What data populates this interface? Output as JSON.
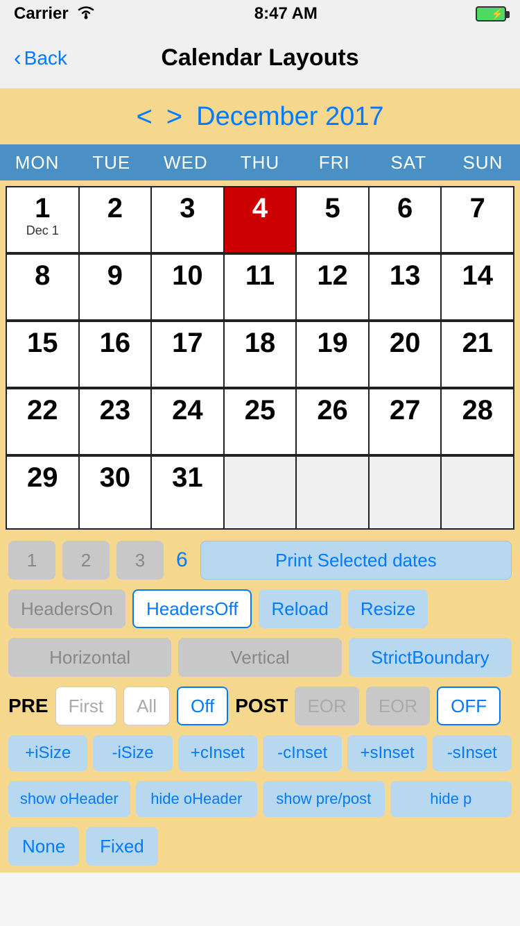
{
  "statusBar": {
    "carrier": "Carrier",
    "time": "8:47 AM"
  },
  "navBar": {
    "backLabel": "Back",
    "title": "Calendar Layouts"
  },
  "calendarHeader": {
    "prevArrow": "<",
    "nextArrow": ">",
    "monthYear": "December 2017"
  },
  "dayHeaders": [
    "MON",
    "TUE",
    "WED",
    "THU",
    "FRI",
    "SAT",
    "SUN"
  ],
  "weeks": [
    [
      {
        "num": "1",
        "sub": "Dec 1",
        "today": false,
        "empty": false
      },
      {
        "num": "2",
        "sub": "",
        "today": false,
        "empty": false
      },
      {
        "num": "3",
        "sub": "",
        "today": false,
        "empty": false
      },
      {
        "num": "4",
        "sub": "",
        "today": true,
        "empty": false
      },
      {
        "num": "5",
        "sub": "",
        "today": false,
        "empty": false
      },
      {
        "num": "6",
        "sub": "",
        "today": false,
        "empty": false
      },
      {
        "num": "7",
        "sub": "",
        "today": false,
        "empty": false
      }
    ],
    [
      {
        "num": "8",
        "sub": "",
        "today": false,
        "empty": false
      },
      {
        "num": "9",
        "sub": "",
        "today": false,
        "empty": false
      },
      {
        "num": "10",
        "sub": "",
        "today": false,
        "empty": false
      },
      {
        "num": "11",
        "sub": "",
        "today": false,
        "empty": false
      },
      {
        "num": "12",
        "sub": "",
        "today": false,
        "empty": false
      },
      {
        "num": "13",
        "sub": "",
        "today": false,
        "empty": false
      },
      {
        "num": "14",
        "sub": "",
        "today": false,
        "empty": false
      }
    ],
    [
      {
        "num": "15",
        "sub": "",
        "today": false,
        "empty": false
      },
      {
        "num": "16",
        "sub": "",
        "today": false,
        "empty": false
      },
      {
        "num": "17",
        "sub": "",
        "today": false,
        "empty": false
      },
      {
        "num": "18",
        "sub": "",
        "today": false,
        "empty": false
      },
      {
        "num": "19",
        "sub": "",
        "today": false,
        "empty": false
      },
      {
        "num": "20",
        "sub": "",
        "today": false,
        "empty": false
      },
      {
        "num": "21",
        "sub": "",
        "today": false,
        "empty": false
      }
    ],
    [
      {
        "num": "22",
        "sub": "",
        "today": false,
        "empty": false
      },
      {
        "num": "23",
        "sub": "",
        "today": false,
        "empty": false
      },
      {
        "num": "24",
        "sub": "",
        "today": false,
        "empty": false
      },
      {
        "num": "25",
        "sub": "",
        "today": false,
        "empty": false
      },
      {
        "num": "26",
        "sub": "",
        "today": false,
        "empty": false
      },
      {
        "num": "27",
        "sub": "",
        "today": false,
        "empty": false
      },
      {
        "num": "28",
        "sub": "",
        "today": false,
        "empty": false
      }
    ],
    [
      {
        "num": "29",
        "sub": "",
        "today": false,
        "empty": false
      },
      {
        "num": "30",
        "sub": "",
        "today": false,
        "empty": false
      },
      {
        "num": "31",
        "sub": "",
        "today": false,
        "empty": false
      },
      {
        "num": "",
        "sub": "",
        "today": false,
        "empty": true
      },
      {
        "num": "",
        "sub": "",
        "today": false,
        "empty": true
      },
      {
        "num": "",
        "sub": "",
        "today": false,
        "empty": true
      },
      {
        "num": "",
        "sub": "",
        "today": false,
        "empty": true
      }
    ]
  ],
  "controls": {
    "numBtns": [
      "1",
      "2",
      "3",
      "6"
    ],
    "printLabel": "Print Selected dates",
    "headersOnLabel": "HeadersOn",
    "headersOffLabel": "HeadersOff",
    "reloadLabel": "Reload",
    "resizeLabel": "Resize",
    "horizontalLabel": "Horizontal",
    "verticalLabel": "Vertical",
    "strictBoundaryLabel": "StrictBoundary",
    "preLabel": "PRE",
    "postLabel": "POST",
    "firstLabel": "First",
    "allLabel": "All",
    "offLabel": "Off",
    "eor1Label": "EOR",
    "eor2Label": "EOR",
    "offActiveLabel": "OFF",
    "sizeBtns": [
      "+iSize",
      "-iSize",
      "+cInset",
      "-cInset",
      "+sInset",
      "-sInset"
    ],
    "oHeaderBtns": [
      "show oHeader",
      "hide oHeader",
      "show pre/post",
      "hide p"
    ],
    "bottomBtns": [
      "None",
      "Fixed"
    ]
  }
}
